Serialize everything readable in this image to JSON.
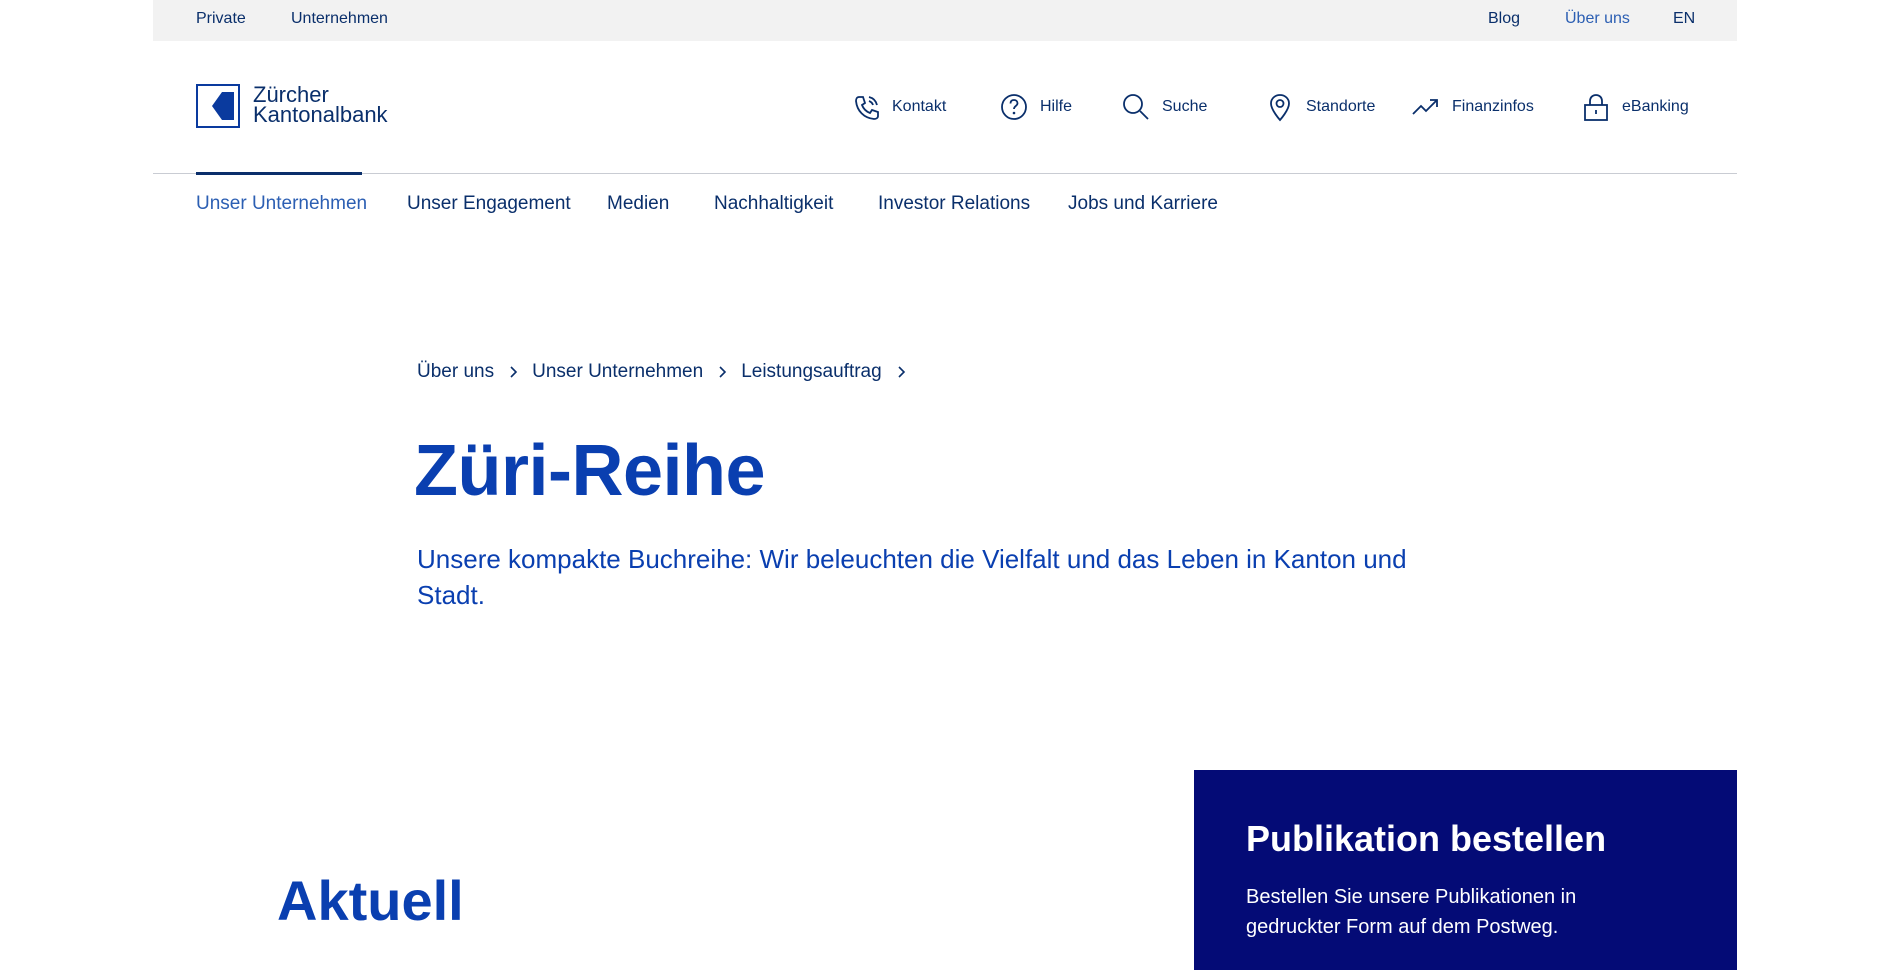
{
  "colors": {
    "primary": "#0a2f6b",
    "accent": "#0a3fb0",
    "active_link": "#2c5fb3",
    "top_bar_bg": "#f2f2f2",
    "promo_bg": "#040b76"
  },
  "topbar": {
    "left": [
      {
        "label": "Private"
      },
      {
        "label": "Unternehmen"
      }
    ],
    "right": [
      {
        "label": "Blog"
      },
      {
        "label": "Über uns"
      },
      {
        "label": "EN"
      }
    ]
  },
  "logo": {
    "text": "Zürcher\nKantonalbank"
  },
  "tools": [
    {
      "label": "Kontakt",
      "icon": "phone-icon"
    },
    {
      "label": "Hilfe",
      "icon": "help-icon"
    },
    {
      "label": "Suche",
      "icon": "search-icon"
    },
    {
      "label": "Standorte",
      "icon": "location-pin-icon"
    },
    {
      "label": "Finanzinfos",
      "icon": "trend-up-icon"
    },
    {
      "label": "eBanking",
      "icon": "lock-icon"
    }
  ],
  "mainnav": [
    {
      "label": "Unser Unternehmen",
      "active": true
    },
    {
      "label": "Unser Engagement"
    },
    {
      "label": "Medien"
    },
    {
      "label": "Nachhaltigkeit"
    },
    {
      "label": "Investor Relations"
    },
    {
      "label": "Jobs und Karriere"
    }
  ],
  "breadcrumb": [
    {
      "label": "Über uns"
    },
    {
      "label": "Unser Unternehmen"
    },
    {
      "label": "Leistungsauftrag"
    }
  ],
  "page": {
    "title": "Züri-Reihe",
    "lead": "Unsere kompakte Buchreihe: Wir beleuchten die Vielfalt und das Leben in Kanton und Stadt.",
    "section_title": "Aktuell"
  },
  "order_box": {
    "title": "Publikation bestellen",
    "text": "Bestellen Sie unsere Publikationen in gedruckter Form auf dem Postweg."
  }
}
